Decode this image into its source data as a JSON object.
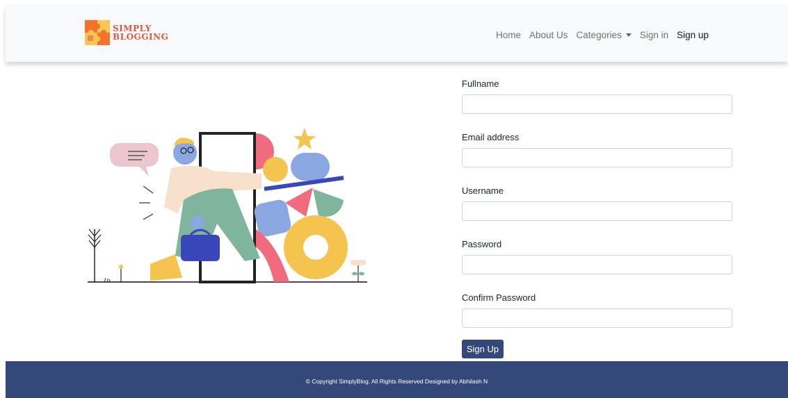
{
  "brand": {
    "line1": "SIMPLY",
    "line2": "BLOGGING"
  },
  "nav": {
    "items": [
      {
        "label": "Home"
      },
      {
        "label": "About Us"
      },
      {
        "label": "Categories"
      },
      {
        "label": "Sign in"
      },
      {
        "label": "Sign up"
      }
    ]
  },
  "form": {
    "fields": [
      {
        "label": "Fullname",
        "value": ""
      },
      {
        "label": "Email address",
        "value": ""
      },
      {
        "label": "Username",
        "value": ""
      },
      {
        "label": "Password",
        "value": ""
      },
      {
        "label": "Confirm Password",
        "value": ""
      }
    ],
    "submit_label": "Sign Up"
  },
  "footer": {
    "text": "© Copyright SimplyBlog. All Rights Reserved Designed by Abhilash N"
  },
  "colors": {
    "primary": "#34497a",
    "brand": "#e8553c",
    "navbar_bg": "#f8f9fa"
  }
}
